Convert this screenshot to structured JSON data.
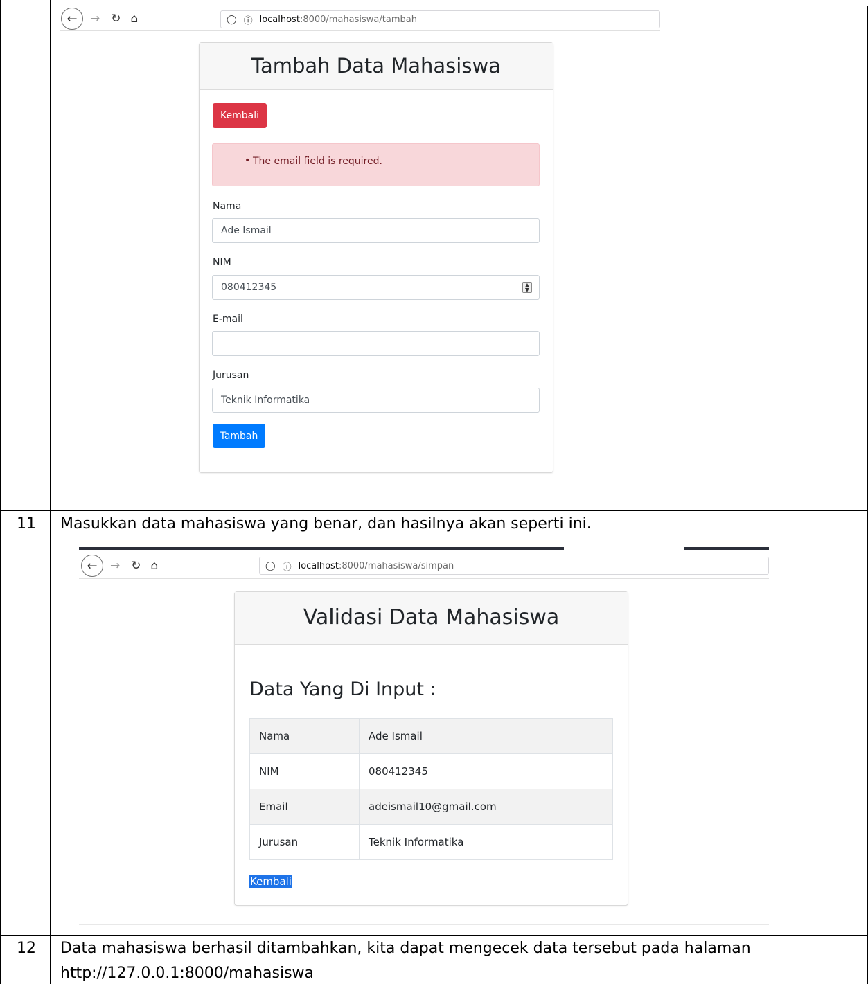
{
  "rows": [
    {
      "number": "11",
      "text": "Masukkan data mahasiswa yang benar, dan hasilnya akan seperti ini."
    },
    {
      "number": "12",
      "text": "Data mahasiswa berhasil ditambahkan, kita dapat mengecek data tersebut pada halaman",
      "text2": "http://127.0.0.1:8000/mahasiswa"
    }
  ],
  "screenshot1": {
    "url_host": "localhost",
    "url_path": ":8000/mahasiswa/tambah",
    "card_title": "Tambah Data Mahasiswa",
    "back_button": "Kembali",
    "alert_message": "The email field is required.",
    "fields": [
      {
        "label": "Nama",
        "value": "Ade Ismail"
      },
      {
        "label": "NIM",
        "value": "080412345"
      },
      {
        "label": "E-mail",
        "value": ""
      },
      {
        "label": "Jurusan",
        "value": "Teknik Informatika"
      }
    ],
    "submit_button": "Tambah"
  },
  "screenshot2": {
    "url_host": "localhost",
    "url_path": ":8000/mahasiswa/simpan",
    "card_title": "Validasi Data Mahasiswa",
    "section_title": "Data Yang Di Input :",
    "table": [
      {
        "key": "Nama",
        "value": "Ade Ismail"
      },
      {
        "key": "NIM",
        "value": "080412345"
      },
      {
        "key": "Email",
        "value": "adeismail10@gmail.com"
      },
      {
        "key": "Jurusan",
        "value": "Teknik Informatika"
      }
    ],
    "back_link": "Kembali"
  },
  "colors": {
    "danger": "#dc3545",
    "primary": "#007bff",
    "alert_bg": "#f8d7da",
    "alert_text": "#721c24"
  }
}
